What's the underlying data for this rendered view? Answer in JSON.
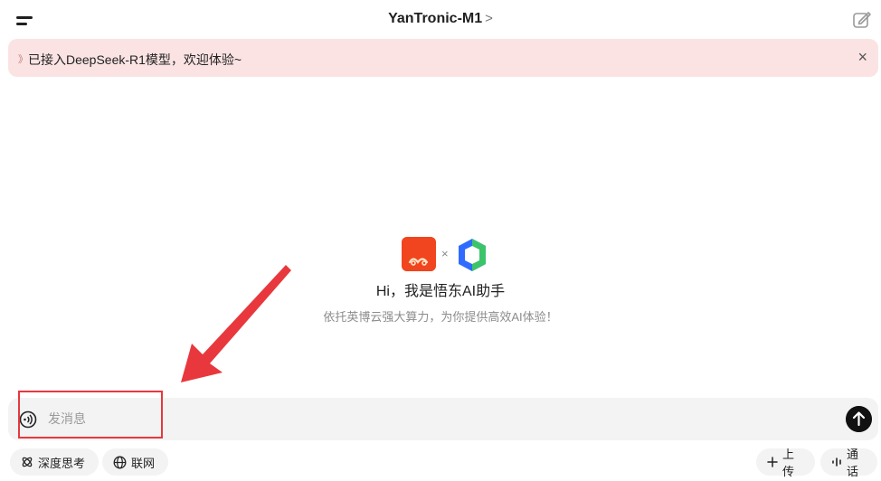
{
  "header": {
    "model_name": "YanTronic-M1",
    "model_chevron": ">"
  },
  "notice": {
    "text": "已接入DeepSeek-R1模型，欢迎体验~",
    "close": "×"
  },
  "hero": {
    "times": "×",
    "title": "Hi，我是悟东AI助手",
    "subtitle": "依托英博云强大算力，为你提供高效AI体验！"
  },
  "composer": {
    "placeholder": "发消息"
  },
  "tools": {
    "deep_think": "深度思考",
    "web": "联网",
    "upload": "上传",
    "call": "通话"
  },
  "colors": {
    "notice_bg": "#fbe3e3",
    "annotation": "#e8383d",
    "logo_orange": "#f0451e",
    "logo_blue": "#2f6bff",
    "logo_green": "#3cc46a"
  }
}
